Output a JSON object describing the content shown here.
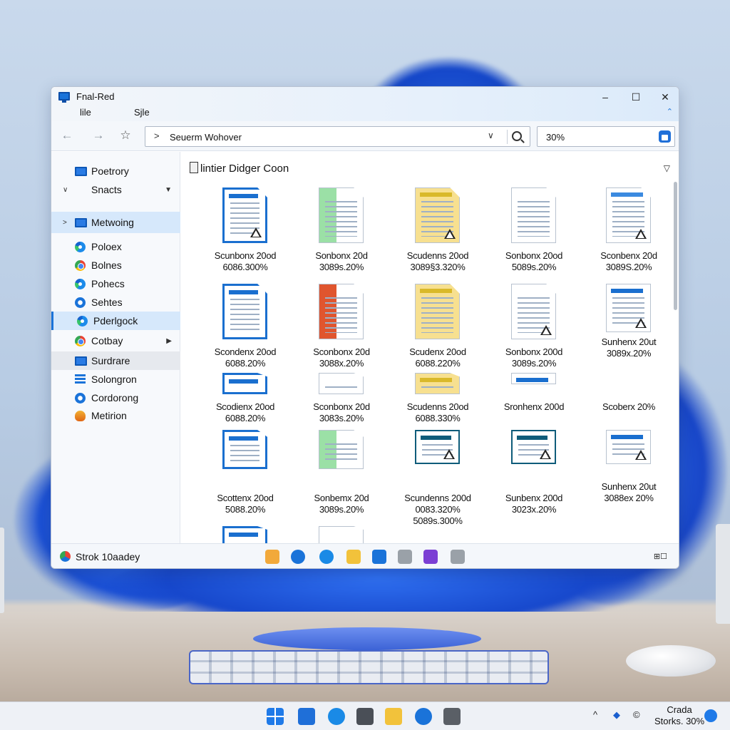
{
  "window": {
    "title": "Fnal-Red",
    "menu": [
      "lile",
      "Sjle"
    ],
    "controls": {
      "minimize": "–",
      "maximize": "☐",
      "close": "✕"
    },
    "expand_glyph": "⌃"
  },
  "toolbar": {
    "back_glyph": "←",
    "forward_glyph": "→",
    "favorite_glyph": "☆",
    "address_sep": ">",
    "address": "Seuerm Wohover",
    "address_dropdown": "∨",
    "zoom": "30%"
  },
  "sidebar": {
    "items": [
      {
        "label": "Poetrory",
        "icon": "monitor-icon",
        "arrow": "",
        "state": ""
      },
      {
        "label": "Snacts",
        "icon": "",
        "arrow": "∨",
        "state": "",
        "right": "▼"
      },
      {
        "label": "Metwoing",
        "icon": "monitor-icon",
        "arrow": ">",
        "state": "selected"
      },
      {
        "label": "Poloex",
        "icon": "edge-icon",
        "arrow": "",
        "state": ""
      },
      {
        "label": "Bolnes",
        "icon": "chrome-icon",
        "arrow": "",
        "state": ""
      },
      {
        "label": "Pohecs",
        "icon": "edge-icon",
        "arrow": "",
        "state": ""
      },
      {
        "label": "Sehtes",
        "icon": "gear-icon",
        "arrow": "",
        "state": ""
      },
      {
        "label": "Pderlgock",
        "icon": "edge-icon",
        "arrow": "",
        "state": "active"
      },
      {
        "label": "Cotbay",
        "icon": "chrome-icon",
        "arrow": "",
        "state": "",
        "right": "▶"
      },
      {
        "label": "Surdrare",
        "icon": "monitor-icon",
        "arrow": "",
        "state": "hover"
      },
      {
        "label": "Solongron",
        "icon": "bars-icon",
        "arrow": "",
        "state": ""
      },
      {
        "label": "Cordorong",
        "icon": "gear-icon",
        "arrow": "",
        "state": ""
      },
      {
        "label": "Metirion",
        "icon": "fire-icon",
        "arrow": "",
        "state": ""
      }
    ]
  },
  "content": {
    "folder_title": "lintier Didger Coon",
    "sort_glyph": "▽",
    "files": [
      {
        "name": "Scunbonx 20od",
        "meta": "6086.300%",
        "style": "blue-report",
        "warn": true
      },
      {
        "name": "Sonbonx 20d",
        "meta": "3089s.20%",
        "style": "green-sheet",
        "warn": false
      },
      {
        "name": "Scudenns 20od",
        "meta": "3089§3.320%",
        "style": "yellow-folder",
        "warn": true
      },
      {
        "name": "Sonbonx 20od",
        "meta": "5089s.20%",
        "style": "gray-sheet",
        "warn": false
      },
      {
        "name": "Sconbenx 20d",
        "meta": "3089S.20%",
        "style": "blue-sheet",
        "warn": true
      },
      {
        "name": "Scondenx 20od",
        "meta": "6088.20%",
        "style": "blue-report",
        "warn": false
      },
      {
        "name": "Sconbonx 20d",
        "meta": "3088x.20%",
        "style": "red-sheet",
        "warn": false
      },
      {
        "name": "Scudenx 20od",
        "meta": "6088.220%",
        "style": "yellow-folder",
        "warn": false
      },
      {
        "name": "Sonbonx 200d",
        "meta": "3089s.20%",
        "style": "gray-sheet",
        "warn": true
      },
      {
        "name": "Sunhenx 20ut",
        "meta": "3089x.20%",
        "style": "blue-panel",
        "warn": true
      },
      {
        "name": "Scodienx 20od",
        "meta": "6088.20%",
        "style": "blue-report",
        "warn": false
      },
      {
        "name": "Sconbonx 20d",
        "meta": "3083s.20%",
        "style": "gray-sheet",
        "warn": false
      },
      {
        "name": "Scudenns 20od",
        "meta": "6088.330%",
        "style": "yellow-folder",
        "warn": false
      },
      {
        "name": "Sronhenx 200d",
        "meta": "",
        "style": "blue-panel",
        "warn": false
      },
      {
        "name": "Scoberx 20%",
        "meta": "",
        "style": "none",
        "warn": false
      },
      {
        "name": "Scottenx 20od",
        "meta": "5088.20%",
        "style": "blue-report",
        "warn": false
      },
      {
        "name": "Sonbemx 20d",
        "meta": "3089s.20%",
        "style": "green-sheet",
        "warn": false
      },
      {
        "name": "Scundenns 200d",
        "meta": "0083.320%\n5089s.300%",
        "style": "teal-panel",
        "warn": true
      },
      {
        "name": "Sunbenx 200d",
        "meta": "3023x.20%",
        "style": "teal-panel",
        "warn": true
      },
      {
        "name": "Sunhenx 20ut",
        "meta": "3088ex 20%",
        "style": "blue-panel",
        "warn": true
      },
      {
        "name": "",
        "meta": "",
        "style": "blue-report",
        "warn": false
      },
      {
        "name": "",
        "meta": "",
        "style": "gray-sheet",
        "warn": false
      }
    ]
  },
  "statusbar": {
    "text": "Strok 10aadey",
    "tray_icons": [
      "folder-icon",
      "edge-icon",
      "edge-icon",
      "folder-icon",
      "store-icon",
      "lock-icon",
      "purple-icon",
      "lock-icon"
    ],
    "view_glyph": "⊞☐"
  },
  "taskbar": {
    "icons": [
      "start-icon",
      "window-icon",
      "edge-icon",
      "notes-icon",
      "folder-icon",
      "edge-icon",
      "camera-icon"
    ],
    "tray": {
      "chevron": "^",
      "pen": "◆",
      "copyright": "©"
    },
    "clock_line1": "Crada",
    "clock_line2": "Storks. 30%"
  },
  "colors": {
    "accent": "#1a73d9",
    "selection": "#d6e8fb",
    "bloom": "#1a4fd4"
  }
}
